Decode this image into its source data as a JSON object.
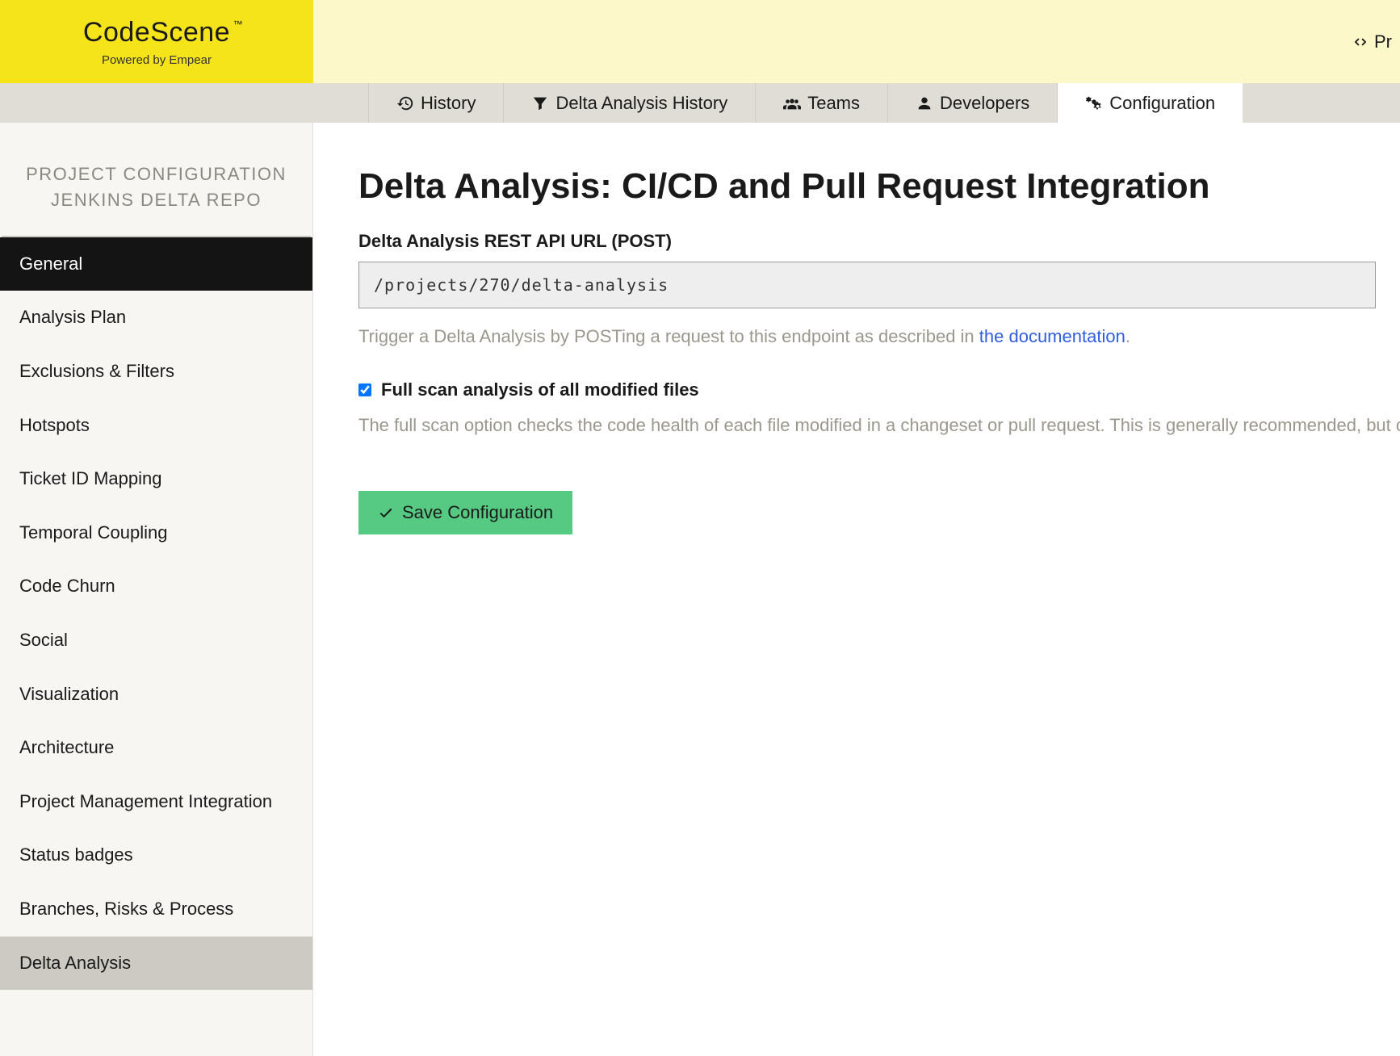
{
  "brand": {
    "name": "CodeScene",
    "tm": "™",
    "sub": "Powered by Empear"
  },
  "topbar_right": {
    "label": "Pr"
  },
  "tabs": {
    "history": "History",
    "delta_history": "Delta Analysis History",
    "teams": "Teams",
    "developers": "Developers",
    "configuration": "Configuration"
  },
  "sidebar": {
    "header_line1": "PROJECT CONFIGURATION",
    "header_line2": "JENKINS DELTA REPO",
    "items": [
      "General",
      "Analysis Plan",
      "Exclusions & Filters",
      "Hotspots",
      "Ticket ID Mapping",
      "Temporal Coupling",
      "Code Churn",
      "Social",
      "Visualization",
      "Architecture",
      "Project Management Integration",
      "Status badges",
      "Branches, Risks & Process",
      "Delta Analysis"
    ]
  },
  "page": {
    "title": "Delta Analysis: CI/CD and Pull Request Integration",
    "api_label": "Delta Analysis REST API URL (POST)",
    "api_url": "/projects/270/delta-analysis",
    "help_prefix": "Trigger a Delta Analysis by POSTing a request to this endpoint as described in ",
    "help_link": "the documentation",
    "help_suffix": ".",
    "checkbox_label": "Full scan analysis of all modified files",
    "checkbox_help": "The full scan option checks the code health of each file modified in a changeset or pull request. This is generally recommended, but on large changesets you might want to uncheck this option for faster processing in the delta analysis. With this option unchecked, CodeScene...",
    "save_label": "Save Configuration"
  }
}
